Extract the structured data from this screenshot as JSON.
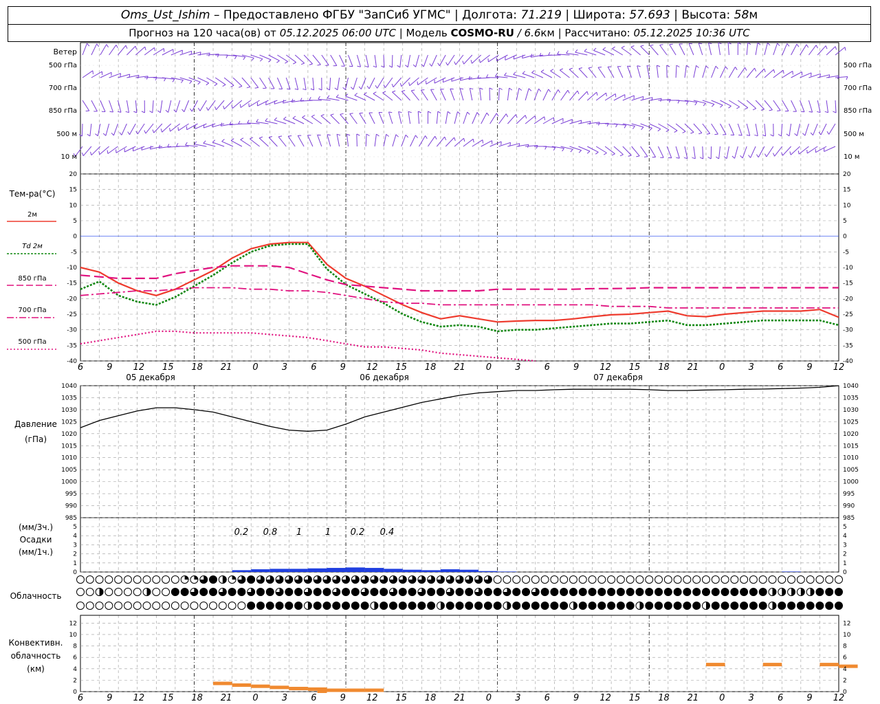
{
  "header": {
    "station": "Oms_Ust_Ishim",
    "dash": " – ",
    "provided": "Предоставлено ФГБУ \"ЗапСиб УГМС\"",
    "sep": " | ",
    "lon_label": "Долгота: ",
    "lon": "71.219",
    "lat_label": "Широта: ",
    "lat": "57.693",
    "alt_label": "Высота: ",
    "alt": "58",
    "alt_unit": "м",
    "forecast_label": "Прогноз на 120 часа(ов) от ",
    "forecast_time": "05.12.2025 06:00 UTC",
    "model_label": "Модель ",
    "model": "COSMO-RU",
    "model_res": " / 6.6",
    "model_res_unit": "км",
    "calc_label": "Рассчитано: ",
    "calc_time": "05.12.2025 10:36 UTC"
  },
  "colors": {
    "wind": "#7a3fd6",
    "t2m": "#ee3b2e",
    "td2m": "#118811",
    "t_levels": "#e0127f",
    "zero_line": "#2244ee",
    "pressure": "#000000",
    "precip": "#1f3fe0",
    "convective": "#f08a30",
    "grid": "#9a9a9a"
  },
  "wind_panel": {
    "title": "Ветер",
    "levels": [
      "500 гПа",
      "700 гПа",
      "850 гПа",
      "500 м",
      "10  м"
    ]
  },
  "temperature_panel": {
    "title": "Тем-ра(°C)",
    "legend": [
      "2м",
      "Td 2м",
      "850 гПа",
      "700 гПа",
      "500 гПа"
    ],
    "ticks": [
      "20",
      "15",
      "10",
      "5",
      "0",
      "-5",
      "-10",
      "-15",
      "-20",
      "-25",
      "-30",
      "-35",
      "-40"
    ]
  },
  "time_axis": {
    "hours": [
      "6",
      "9",
      "12",
      "15",
      "18",
      "21",
      "0",
      "3",
      "6",
      "9",
      "12",
      "15",
      "18",
      "21",
      "0",
      "3",
      "6",
      "9",
      "12",
      "15",
      "18",
      "21",
      "0",
      "3",
      "6",
      "9",
      "12"
    ],
    "dates": [
      "05 декабря",
      "06 декабря",
      "07 декабря"
    ]
  },
  "pressure_panel": {
    "title": "Давление",
    "unit": "(гПа)",
    "ticks": [
      "1040",
      "1035",
      "1030",
      "1025",
      "1020",
      "1015",
      "1010",
      "1005",
      "1000",
      "995",
      "990",
      "985"
    ]
  },
  "precip_panel": {
    "label1": "(мм/3ч.)",
    "label2": "Осадки",
    "label3": "(мм/1ч.)",
    "ticks": [
      "5",
      "4",
      "3",
      "2",
      "1",
      "0"
    ],
    "totals": [
      "0.2",
      "0.8",
      "1",
      "1",
      "0.2",
      "0.4"
    ]
  },
  "cloud_panel": {
    "title": "Облачность"
  },
  "convective_panel": {
    "label1": "Конвективн.",
    "label2": "облачность",
    "label3": "(км)",
    "ticks": [
      "12",
      "10",
      "8",
      "6",
      "4",
      "2",
      "0"
    ]
  },
  "chart_data": [
    {
      "type": "line",
      "title": "Тем-ра(°C)",
      "ylim": [
        -40,
        20
      ],
      "x_hours": [
        0,
        3,
        6,
        9,
        12,
        15,
        18,
        21,
        24,
        27,
        30,
        33,
        36,
        39,
        42,
        45,
        48,
        51,
        54,
        57,
        60,
        63,
        66,
        69,
        72,
        75,
        78,
        81,
        84,
        87,
        90,
        93,
        96,
        99,
        102,
        105,
        108,
        111,
        114,
        117,
        120
      ],
      "series": [
        {
          "name": "2м",
          "values": [
            -10,
            -11.5,
            -15,
            -17.5,
            -19,
            -17,
            -14,
            -11,
            -7,
            -4,
            -2.5,
            -2,
            -2,
            -9,
            -13.5,
            -16,
            -19,
            -22,
            -24.5,
            -26.5,
            -25.5,
            -26.5,
            -27.5,
            -27.2,
            -27,
            -27,
            -26.5,
            -25.8,
            -25.2,
            -25,
            -24.5,
            -24,
            -25.5,
            -25.8,
            -25,
            -24.5,
            -24,
            -24,
            -24,
            -23.5,
            -26
          ]
        },
        {
          "name": "Td 2м",
          "values": [
            -17,
            -14.5,
            -19,
            -21,
            -22,
            -19.5,
            -16,
            -12.5,
            -8.5,
            -5,
            -3,
            -2.5,
            -2.5,
            -10.5,
            -15.5,
            -18.5,
            -21.5,
            -25,
            -27.5,
            -29,
            -28.5,
            -29,
            -30.5,
            -30,
            -30,
            -29.5,
            -29,
            -28.5,
            -28,
            -28,
            -27.5,
            -27,
            -28.5,
            -28.5,
            -28,
            -27.5,
            -27,
            -27,
            -27,
            -27,
            -28.5
          ]
        },
        {
          "name": "850 гПа",
          "values": [
            -12.5,
            -13,
            -13.5,
            -13.5,
            -13.5,
            -12,
            -11,
            -10,
            -9.5,
            -9.5,
            -9.5,
            -10,
            -12,
            -14,
            -15.5,
            -16,
            -16.5,
            -17,
            -17.5,
            -17.5,
            -17.5,
            -17.5,
            -17,
            -17,
            -17,
            -17,
            -17,
            -16.8,
            -16.8,
            -16.7,
            -16.5,
            -16.5,
            -16.5,
            -16.5,
            -16.5,
            -16.5,
            -16.5,
            -16.5,
            -16.5,
            -16.5,
            -16.5
          ]
        },
        {
          "name": "700 гПа",
          "values": [
            -19,
            -18.5,
            -18,
            -17.5,
            -17.5,
            -17,
            -16.5,
            -16.5,
            -16.5,
            -17,
            -17,
            -17.5,
            -17.5,
            -18,
            -19,
            -20,
            -21,
            -21.5,
            -21.5,
            -22,
            -22,
            -22,
            -22,
            -22,
            -22,
            -22,
            -22,
            -22,
            -22.5,
            -22.5,
            -22.5,
            -23,
            -23,
            -23,
            -23,
            -23,
            -23,
            -23,
            -23,
            -23,
            -23
          ]
        },
        {
          "name": "500 гПа",
          "values": [
            -34.5,
            -33.5,
            -32.5,
            -31.5,
            -30.5,
            -30.5,
            -31,
            -31,
            -31,
            -31,
            -31.5,
            -32,
            -32.5,
            -33.5,
            -34.5,
            -35.5,
            -35.5,
            -36,
            -36.5,
            -37.5,
            -38,
            -38.5,
            -39,
            -39.5,
            -40,
            null,
            null,
            null,
            null,
            null,
            null,
            null,
            null,
            null,
            null,
            null,
            null,
            null,
            null,
            null,
            null
          ]
        }
      ]
    },
    {
      "type": "line",
      "title": "Давление",
      "ylim": [
        985,
        1040
      ],
      "x_hours": [
        0,
        3,
        6,
        9,
        12,
        15,
        18,
        21,
        24,
        27,
        30,
        33,
        36,
        39,
        42,
        45,
        48,
        51,
        54,
        57,
        60,
        63,
        66,
        69,
        72,
        75,
        78,
        81,
        84,
        87,
        90,
        93,
        96,
        99,
        102,
        105,
        108,
        111,
        114,
        117,
        120
      ],
      "series": [
        {
          "name": "Давление",
          "values": [
            1022.5,
            1025.5,
            1027.5,
            1029.5,
            1030.8,
            1030.8,
            1030,
            1029,
            1027,
            1025,
            1023,
            1021.5,
            1021,
            1021.5,
            1024,
            1027,
            1029,
            1031,
            1033,
            1034.5,
            1036,
            1037,
            1037.5,
            1038,
            1038,
            1038.3,
            1038.5,
            1038.5,
            1038.5,
            1038.5,
            1038.3,
            1038,
            1038,
            1038.2,
            1038.3,
            1038.5,
            1038.6,
            1038.8,
            1039,
            1039.3,
            1040
          ]
        }
      ]
    },
    {
      "type": "bar",
      "title": "Осадки",
      "ylim": [
        0,
        5
      ],
      "x_hours": [
        24,
        27,
        30,
        33,
        36,
        39,
        42,
        45,
        48,
        51,
        54,
        57,
        60,
        63,
        66,
        69,
        72,
        75,
        78,
        81,
        84,
        87,
        90,
        93,
        96,
        99,
        102,
        105,
        108,
        111,
        114,
        117
      ],
      "series": [
        {
          "name": "мм/1ч.",
          "values": [
            0.2,
            0.3,
            0.35,
            0.35,
            0.4,
            0.45,
            0.5,
            0.45,
            0.35,
            0.25,
            0.2,
            0.3,
            0.25,
            0.1,
            0.05,
            0,
            0,
            0,
            0,
            0,
            0,
            0,
            0,
            0,
            0,
            0,
            0,
            0,
            0,
            0.05,
            0,
            0
          ]
        }
      ]
    },
    {
      "type": "bar",
      "title": "Конвективн. облачность",
      "ylim": [
        0,
        12
      ],
      "x_hours": [
        0,
        3,
        6,
        9,
        12,
        15,
        18,
        21,
        24,
        27,
        30,
        33,
        36,
        39,
        42,
        45,
        48,
        51,
        54,
        57,
        60,
        63,
        66,
        69,
        72,
        75,
        78,
        81,
        84,
        87,
        90,
        93,
        96,
        99,
        102,
        105,
        108,
        111,
        114,
        117,
        120
      ],
      "series": [
        {
          "name": "нижняя граница",
          "values": [
            null,
            null,
            null,
            null,
            null,
            null,
            null,
            1.5,
            1.2,
            1.0,
            0.8,
            0.6,
            0.5,
            0.3,
            0.3,
            0.3,
            null,
            null,
            null,
            null,
            null,
            null,
            null,
            null,
            null,
            null,
            null,
            null,
            null,
            null,
            null,
            null,
            null,
            null,
            null,
            null,
            null,
            null,
            null,
            null,
            null
          ]
        },
        {
          "name": "верхняя граница",
          "values": [
            null,
            null,
            null,
            null,
            null,
            null,
            null,
            null,
            null,
            null,
            null,
            null,
            null,
            null,
            null,
            null,
            null,
            null,
            null,
            null,
            null,
            null,
            null,
            null,
            null,
            null,
            null,
            null,
            null,
            null,
            null,
            null,
            null,
            4.8,
            null,
            null,
            4.8,
            null,
            null,
            4.8,
            4.5
          ]
        }
      ]
    }
  ]
}
